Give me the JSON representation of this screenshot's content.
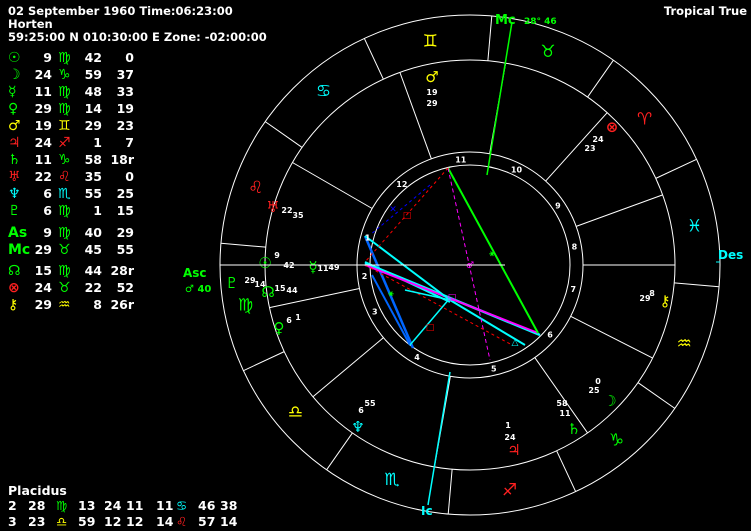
{
  "header": {
    "date_time": "02 September 1960 Time:06:23:00",
    "place": "Horten",
    "coords": "59:25:00 N 010:30:00 E  Zone: -02:00:00",
    "zodiac_mode": "Tropical True"
  },
  "positions": [
    {
      "glyph": "☉",
      "deg": "9",
      "sign": "♍",
      "min": "42",
      "sec": "0",
      "color": "#00ff00",
      "sign_color": "#00ff00"
    },
    {
      "glyph": "☽",
      "deg": "24",
      "sign": "♑",
      "min": "59",
      "sec": "37",
      "color": "#00ff00",
      "sign_color": "#00ff00"
    },
    {
      "glyph": "☿",
      "deg": "11",
      "sign": "♍",
      "min": "48",
      "sec": "33",
      "color": "#00ff00",
      "sign_color": "#00ff00"
    },
    {
      "glyph": "♀",
      "deg": "29",
      "sign": "♍",
      "min": "14",
      "sec": "19",
      "color": "#00ff00",
      "sign_color": "#00ff00"
    },
    {
      "glyph": "♂",
      "deg": "19",
      "sign": "♊",
      "min": "29",
      "sec": "23",
      "color": "#ffff00",
      "sign_color": "#ffff00"
    },
    {
      "glyph": "♃",
      "deg": "24",
      "sign": "♐",
      "min": "1",
      "sec": "7",
      "color": "#ff2020",
      "sign_color": "#ff2020"
    },
    {
      "glyph": "♄",
      "deg": "11",
      "sign": "♑",
      "min": "58",
      "sec": "18r",
      "color": "#00ff00",
      "sign_color": "#00ff00"
    },
    {
      "glyph": "♅",
      "deg": "22",
      "sign": "♌",
      "min": "35",
      "sec": "0",
      "color": "#ff2020",
      "sign_color": "#ff2020"
    },
    {
      "glyph": "♆",
      "deg": "6",
      "sign": "♏",
      "min": "55",
      "sec": "25",
      "color": "#00ffff",
      "sign_color": "#00ffff"
    },
    {
      "glyph": "♇",
      "deg": "6",
      "sign": "♍",
      "min": "1",
      "sec": "15",
      "color": "#00ff00",
      "sign_color": "#00ff00"
    },
    {
      "glyph": "As",
      "deg": "9",
      "sign": "♍",
      "min": "40",
      "sec": "29",
      "color": "#00ff00",
      "sign_color": "#00ff00"
    },
    {
      "glyph": "Mc",
      "deg": "29",
      "sign": "♉",
      "min": "45",
      "sec": "55",
      "color": "#00ff00",
      "sign_color": "#00ff00"
    },
    {
      "glyph": "☊",
      "deg": "15",
      "sign": "♍",
      "min": "44",
      "sec": "28r",
      "color": "#00ff00",
      "sign_color": "#00ff00"
    },
    {
      "glyph": "⊗",
      "deg": "24",
      "sign": "♉",
      "min": "22",
      "sec": "52",
      "color": "#ff2020",
      "sign_color": "#00ff00"
    },
    {
      "glyph": "⚷",
      "deg": "29",
      "sign": "♒",
      "min": "8",
      "sec": "26r",
      "color": "#ffff00",
      "sign_color": "#ffff00"
    }
  ],
  "houses": {
    "system": "Placidus",
    "row1": [
      {
        "text": "2",
        "color": "#fff"
      },
      {
        "text": "28",
        "color": "#fff"
      },
      {
        "text": "♍",
        "color": "#00ff00"
      },
      {
        "text": "13",
        "color": "#fff"
      },
      {
        "text": "24",
        "color": "#fff"
      },
      {
        "text": "11",
        "color": "#fff"
      },
      {
        "text": "11",
        "color": "#fff"
      },
      {
        "text": "♋",
        "color": "#00ffff"
      },
      {
        "text": "46",
        "color": "#fff"
      },
      {
        "text": "38",
        "color": "#fff"
      }
    ],
    "row2": [
      {
        "text": "3",
        "color": "#fff"
      },
      {
        "text": "23",
        "color": "#fff"
      },
      {
        "text": "♎",
        "color": "#ffff00"
      },
      {
        "text": "59",
        "color": "#fff"
      },
      {
        "text": "12",
        "color": "#fff"
      },
      {
        "text": "12",
        "color": "#fff"
      },
      {
        "text": "14",
        "color": "#fff"
      },
      {
        "text": "♌",
        "color": "#ff2020"
      },
      {
        "text": "57",
        "color": "#fff"
      },
      {
        "text": "14",
        "color": "#fff"
      }
    ]
  },
  "wheel": {
    "axis_labels": {
      "asc": "Asc",
      "des": "Des",
      "mc": "Mc",
      "ic": "Ic"
    },
    "asc_sub": "♂ 40",
    "mc_sub": "28° 46",
    "zodiac": [
      {
        "glyph": "♊",
        "color": "#ffff00"
      },
      {
        "glyph": "♉",
        "color": "#00ff00"
      },
      {
        "glyph": "♈",
        "color": "#ff2020"
      },
      {
        "glyph": "♓",
        "color": "#00ffff"
      },
      {
        "glyph": "♒",
        "color": "#ffff00"
      },
      {
        "glyph": "♑",
        "color": "#00ff00"
      },
      {
        "glyph": "♐",
        "color": "#ff2020"
      },
      {
        "glyph": "♏",
        "color": "#00ffff"
      },
      {
        "glyph": "♎",
        "color": "#ffff00"
      },
      {
        "glyph": "♍",
        "color": "#00ff00"
      },
      {
        "glyph": "♌",
        "color": "#ff2020"
      },
      {
        "glyph": "♋",
        "color": "#00ffff"
      }
    ],
    "house_numbers": [
      "10",
      "9",
      "8",
      "7",
      "6",
      "5",
      "4",
      "3",
      "2",
      "1",
      "12",
      "11"
    ],
    "planets": [
      {
        "glyph": "♂",
        "color": "#ffff00",
        "deg": "19",
        "min": "29"
      },
      {
        "glyph": "⊗",
        "color": "#ff2020",
        "deg": "24",
        "min": "23"
      },
      {
        "glyph": "♅",
        "color": "#ff2020",
        "deg": "22",
        "min": "35"
      },
      {
        "glyph": "♀",
        "color": "#00ff00",
        "deg": "6",
        "min": "1"
      },
      {
        "glyph": "☉",
        "color": "#00ff00",
        "deg": "9",
        "min": "42"
      },
      {
        "glyph": "☿",
        "color": "#00ff00",
        "deg": "11",
        "min": "49"
      },
      {
        "glyph": "☊",
        "color": "#00ff00",
        "deg": "15",
        "min": "44"
      },
      {
        "glyph": "♇",
        "color": "#00ff00",
        "deg": "29",
        "min": "14"
      },
      {
        "glyph": "⚷",
        "color": "#ffff00",
        "deg": "8",
        "min": "29"
      },
      {
        "glyph": "☽",
        "color": "#00ff00",
        "deg": "0",
        "min": "25"
      },
      {
        "glyph": "♄",
        "color": "#00ff00",
        "deg": "58",
        "min": "11"
      },
      {
        "glyph": "♃",
        "color": "#ff2020",
        "deg": "1",
        "min": "24"
      },
      {
        "glyph": "♆",
        "color": "#00ffff",
        "deg": "6",
        "min": "55"
      }
    ]
  }
}
